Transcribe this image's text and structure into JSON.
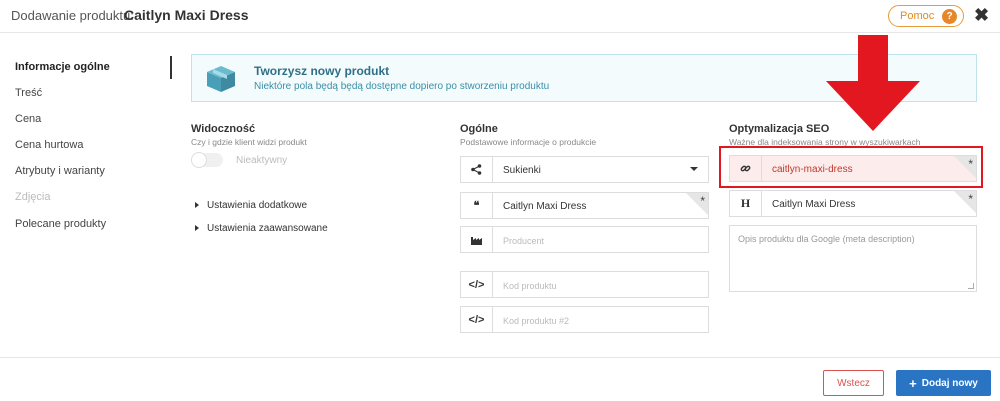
{
  "header": {
    "label": "Dodawanie produktu:",
    "title": "Caitlyn Maxi Dress",
    "help_label": "Pomoc",
    "help_icon": "?",
    "close_icon": "✖"
  },
  "sidebar": {
    "items": [
      {
        "label": "Informacje ogólne",
        "state": "active"
      },
      {
        "label": "Treść",
        "state": "normal"
      },
      {
        "label": "Cena",
        "state": "normal"
      },
      {
        "label": "Cena hurtowa",
        "state": "normal"
      },
      {
        "label": "Atrybuty i warianty",
        "state": "normal"
      },
      {
        "label": "Zdjęcia",
        "state": "disabled"
      },
      {
        "label": "Polecane produkty",
        "state": "normal"
      }
    ]
  },
  "banner": {
    "title": "Tworzysz nowy produkt",
    "subtitle": "Niektóre pola będą będą dostępne dopiero po stworzeniu produktu"
  },
  "visibility": {
    "title": "Widoczność",
    "subtitle": "Czy i gdzie klient widzi produkt",
    "toggle_label": "Nieaktywny",
    "expanders": [
      "Ustawienia dodatkowe",
      "Ustawienia zaawansowane"
    ]
  },
  "general": {
    "title": "Ogólne",
    "subtitle": "Podstawowe informacje o produkcie",
    "category_value": "Sukienki",
    "name_value": "Caitlyn Maxi Dress",
    "producer_placeholder": "Producent",
    "code_placeholder": "Kod produktu",
    "code2_placeholder": "Kod produktu #2",
    "required_mark": "*"
  },
  "seo": {
    "title": "Optymalizacja SEO",
    "subtitle": "Ważne dla indeksowania strony w wyszukiwarkach",
    "slug_value": "caitlyn-maxi-dress",
    "heading_value": "Caitlyn Maxi Dress",
    "heading_icon": "H",
    "description_placeholder": "Opis produktu dla Google (meta description)"
  },
  "footer": {
    "back_label": "Wstecz",
    "add_label": "Dodaj nowy",
    "add_icon": "+"
  },
  "colors": {
    "accent_blue": "#2a74c4",
    "highlight_red": "#e3171f",
    "help_orange": "#e8862a"
  }
}
